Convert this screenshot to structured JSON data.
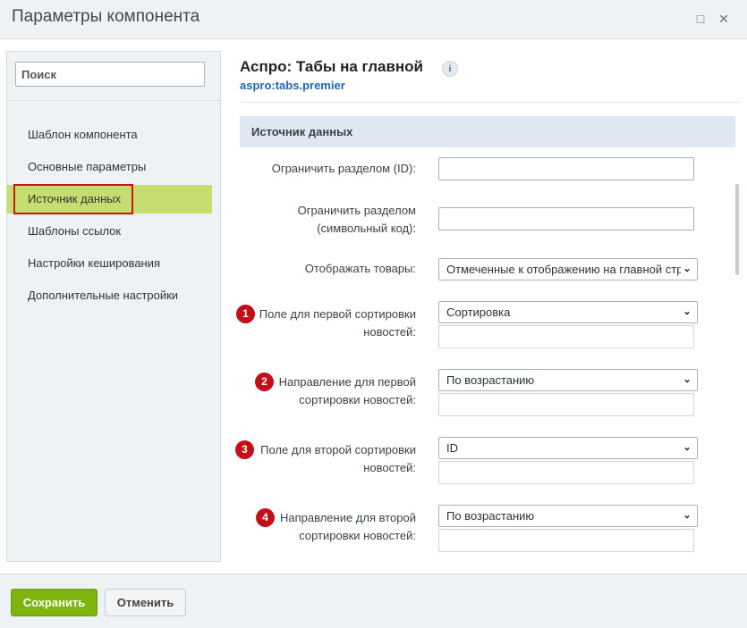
{
  "window": {
    "title": "Параметры компонента",
    "maximize_icon": "maximize-icon",
    "close_icon": "close-icon"
  },
  "sidebar": {
    "search": {
      "placeholder": "Поиск",
      "value": ""
    },
    "items": [
      {
        "label": "Шаблон компонента",
        "active": false
      },
      {
        "label": "Основные параметры",
        "active": false
      },
      {
        "label": "Источник данных",
        "active": true
      },
      {
        "label": "Шаблоны ссылок",
        "active": false
      },
      {
        "label": "Настройки кеширования",
        "active": false
      },
      {
        "label": "Дополнительные настройки",
        "active": false
      }
    ]
  },
  "component": {
    "title": "Аспро: Табы на главной",
    "code": "aspro:tabs.premier",
    "info_icon": "i"
  },
  "section": {
    "title": "Источник данных"
  },
  "fields": {
    "section_id": {
      "label": "Ограничить разделом (ID):",
      "value": ""
    },
    "section_code": {
      "label_1": "Ограничить разделом",
      "label_2": "(символьный код):",
      "value": ""
    },
    "display": {
      "label": "Отображать товары:",
      "value": "Отмеченные к отображению на главной странице"
    },
    "sort1": {
      "badge": "1",
      "label_1": "Поле для первой сортировки",
      "label_2": "новостей:",
      "value": "Сортировка",
      "extra": ""
    },
    "order1": {
      "badge": "2",
      "label_1": "Направление для первой",
      "label_2": "сортировки новостей:",
      "value": "По возрастанию",
      "extra": ""
    },
    "sort2": {
      "badge": "3",
      "label_1": "Поле для второй сортировки",
      "label_2": "новостей:",
      "value": "ID",
      "extra": ""
    },
    "order2": {
      "badge": "4",
      "label_1": "Направление для второй",
      "label_2": "сортировки новостей:",
      "value": "По возрастанию",
      "extra": ""
    }
  },
  "footer": {
    "save_label": "Сохранить",
    "cancel_label": "Отменить"
  },
  "colors": {
    "active_item": "#c6dd6f",
    "highlight_border": "#d0111b",
    "badge": "#c20f18",
    "save_button": "#7fb40f",
    "link": "#2067b0",
    "section_header": "#dfe8f1"
  }
}
